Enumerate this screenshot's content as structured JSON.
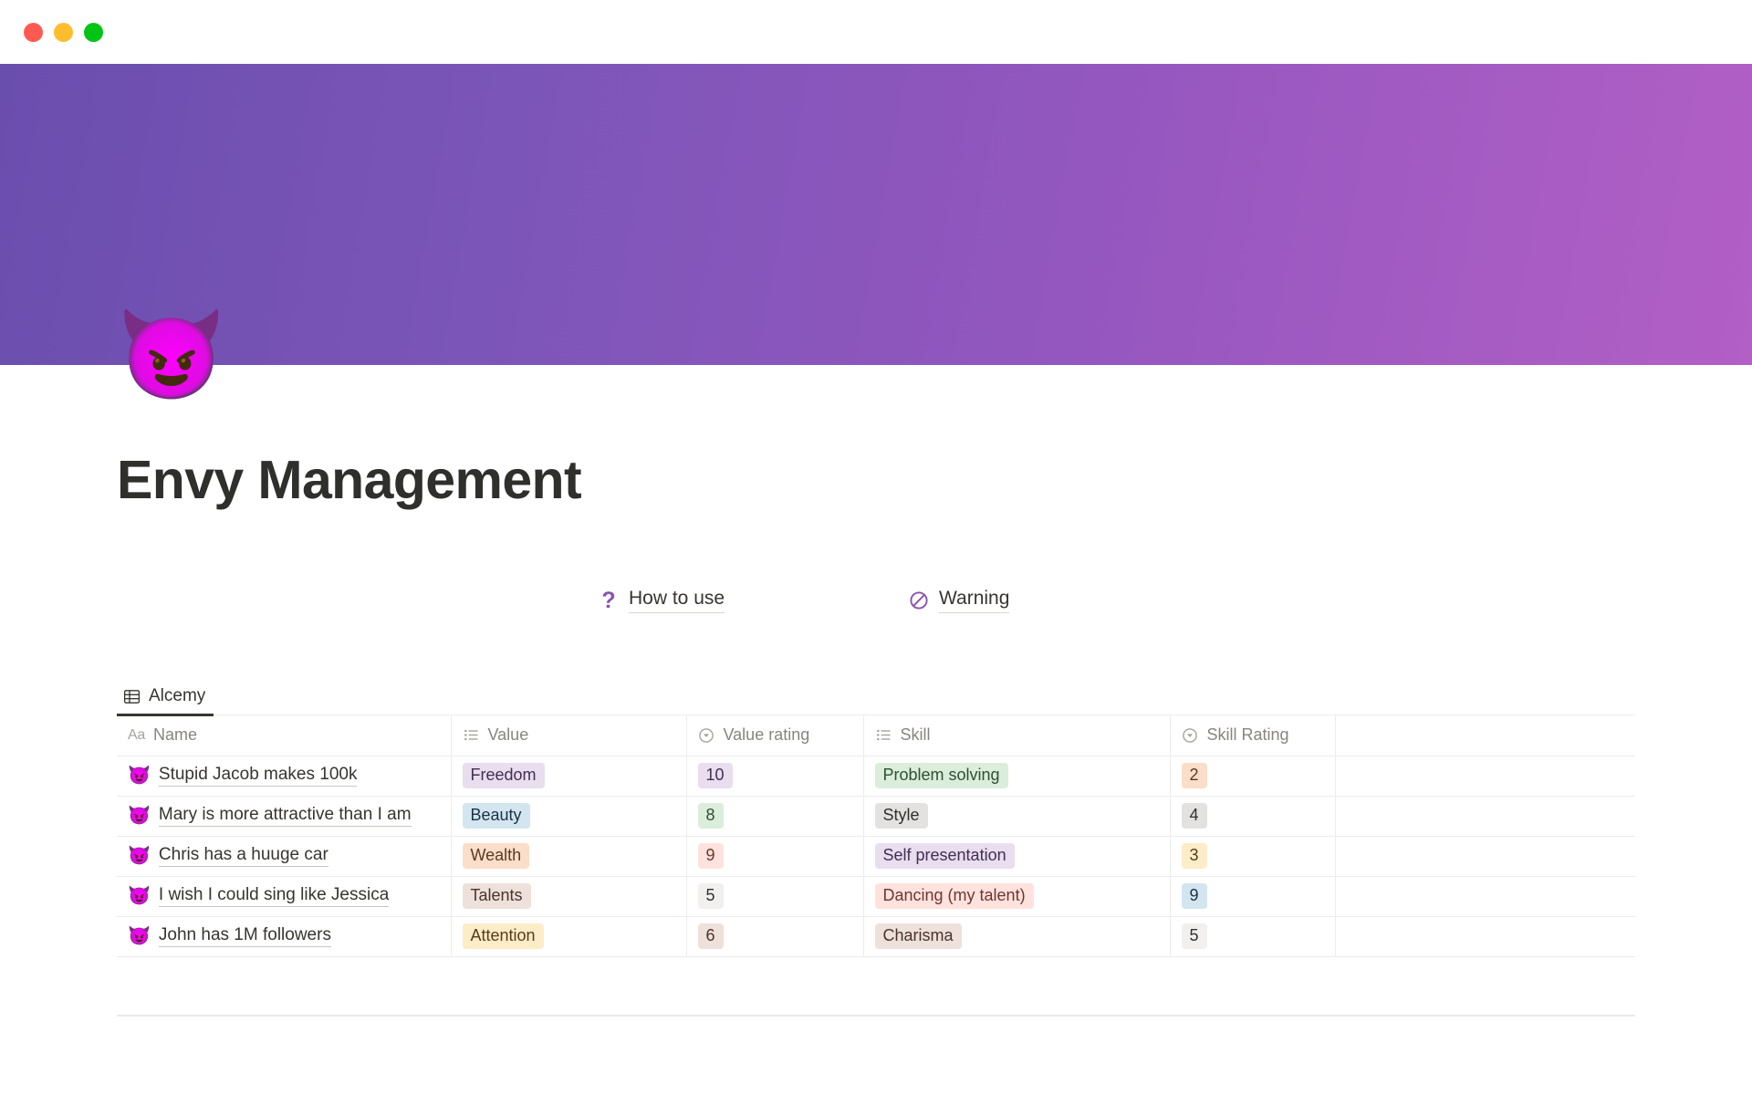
{
  "window": {
    "traffic_lights": [
      {
        "name": "close",
        "color": "#FF5A52"
      },
      {
        "name": "minimize",
        "color": "#FFBD2E"
      },
      {
        "name": "zoom",
        "color": "#00C514"
      }
    ]
  },
  "cover": {
    "gradient_from": "#6A4EAE",
    "gradient_to": "#B25FC6"
  },
  "page": {
    "icon": "😈",
    "title": "Envy Management"
  },
  "links": [
    {
      "id": "howto",
      "icon": "question-mark-icon",
      "glyph": "?",
      "label": "How to use"
    },
    {
      "id": "warning",
      "icon": "prohibited-icon",
      "glyph": "🚫",
      "label": "Warning"
    }
  ],
  "database": {
    "tabs": [
      {
        "label": "Alcemy",
        "icon": "table-view-icon",
        "active": true
      }
    ],
    "columns": [
      {
        "key": "name",
        "label": "Name",
        "icon": "title-text-icon"
      },
      {
        "key": "value",
        "label": "Value",
        "icon": "multi-select-icon"
      },
      {
        "key": "value_rating",
        "label": "Value rating",
        "icon": "select-icon"
      },
      {
        "key": "skill",
        "label": "Skill",
        "icon": "multi-select-icon"
      },
      {
        "key": "skill_rating",
        "label": "Skill Rating",
        "icon": "select-icon"
      },
      {
        "key": "blank",
        "label": "",
        "icon": ""
      }
    ],
    "rows": [
      {
        "emoji": "😈",
        "name": "Stupid Jacob makes 100k",
        "value": "Freedom",
        "value_bg": "#E8DEEE",
        "value_fg": "#442E54",
        "value_rating": "10",
        "vrate_bg": "#E8DEEE",
        "vrate_fg": "#442E54",
        "skill": "Problem solving",
        "skill_bg": "#DBEDDB",
        "skill_fg": "#2F4F33",
        "skill_rating": "2",
        "srate_bg": "#FADEC9",
        "srate_fg": "#5C3A22"
      },
      {
        "emoji": "😈",
        "name": "Mary is more attractive than I am",
        "value": "Beauty",
        "value_bg": "#D3E5EF",
        "value_fg": "#183347",
        "value_rating": "8",
        "vrate_bg": "#DBEDDB",
        "vrate_fg": "#2F4F33",
        "skill": "Style",
        "skill_bg": "#E3E2E0",
        "skill_fg": "#32302C",
        "skill_rating": "4",
        "srate_bg": "#E3E2E0",
        "srate_fg": "#32302C"
      },
      {
        "emoji": "😈",
        "name": "Chris has a huuge car",
        "value": "Wealth",
        "value_bg": "#FADEC9",
        "value_fg": "#5C3A22",
        "value_rating": "9",
        "vrate_bg": "#FFE2DD",
        "vrate_fg": "#6E3630",
        "skill": "Self presentation",
        "skill_bg": "#E8DEEE",
        "skill_fg": "#442E54",
        "skill_rating": "3",
        "srate_bg": "#FDECC8",
        "srate_fg": "#583B1A"
      },
      {
        "emoji": "😈",
        "name": "I wish I could sing like Jessica",
        "value": "Talents",
        "value_bg": "#EEE0DA",
        "value_fg": "#4A342C",
        "value_rating": "5",
        "vrate_bg": "#F1F0EF",
        "vrate_fg": "#32302C",
        "skill": "Dancing (my talent)",
        "skill_bg": "#FFE2DD",
        "skill_fg": "#6E3630",
        "skill_rating": "9",
        "srate_bg": "#D3E5EF",
        "srate_fg": "#183347"
      },
      {
        "emoji": "😈",
        "name": "John has 1M followers",
        "value": "Attention",
        "value_bg": "#FDECC8",
        "value_fg": "#583B1A",
        "value_rating": "6",
        "vrate_bg": "#EEE0DA",
        "vrate_fg": "#4A342C",
        "skill": "Charisma",
        "skill_bg": "#EEE0DA",
        "skill_fg": "#4A342C",
        "skill_rating": "5",
        "srate_bg": "#F1F0EF",
        "srate_fg": "#32302C"
      }
    ]
  }
}
